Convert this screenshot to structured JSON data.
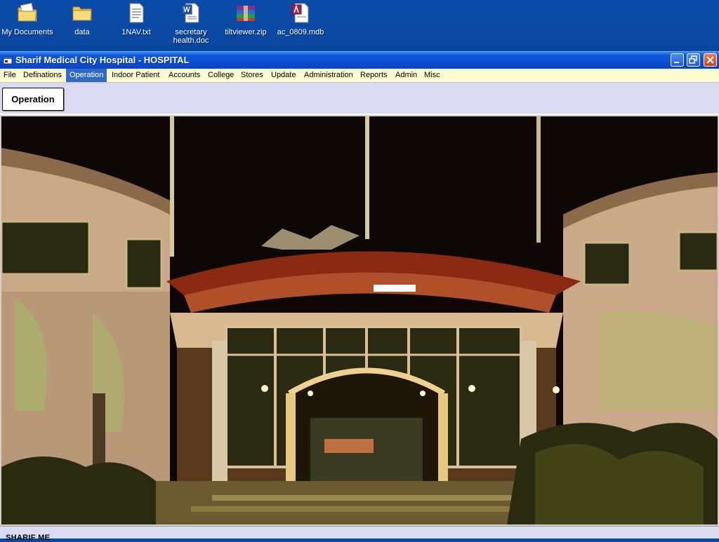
{
  "desktop": {
    "icons": [
      {
        "label": "My Documents"
      },
      {
        "label": "data"
      },
      {
        "label": "1NAV.txt"
      },
      {
        "label": "secretary health.doc"
      },
      {
        "label": "tiltviewer.zip"
      },
      {
        "label": "ac_0809.mdb"
      }
    ]
  },
  "window": {
    "title": "Sharif Medical City Hospital - HOSPITAL"
  },
  "menu": {
    "items": [
      {
        "label": "File"
      },
      {
        "label": "Definations"
      },
      {
        "label": "Operation"
      },
      {
        "label": "Indoor Patient"
      },
      {
        "label": "Accounts"
      },
      {
        "label": "College"
      },
      {
        "label": "Stores"
      },
      {
        "label": "Update"
      },
      {
        "label": "Administration"
      },
      {
        "label": "Reports"
      },
      {
        "label": "Admin"
      },
      {
        "label": "Misc"
      }
    ],
    "active": "Operation"
  },
  "toolbar": {
    "operation_label": "Operation"
  },
  "status": {
    "text": "SHARIF ME"
  },
  "colors": {
    "desktop": "#0a4aa6",
    "menubar": "#fdfbd1",
    "menu_active": "#316ac5",
    "toolbar": "#dadaf2"
  }
}
